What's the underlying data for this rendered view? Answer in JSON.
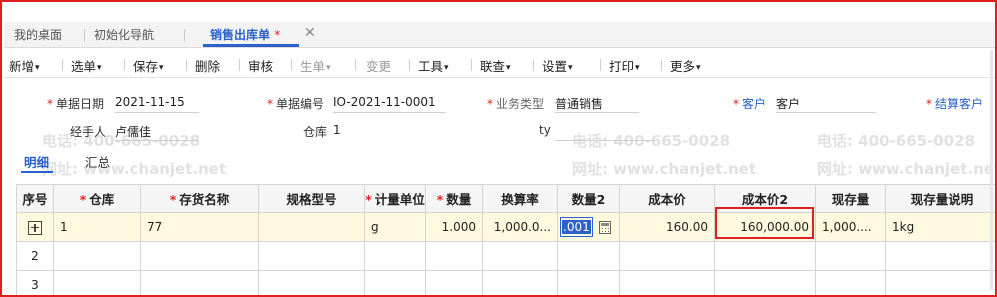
{
  "tabs": {
    "items": [
      {
        "label": "我的桌面"
      },
      {
        "label": "初始化导航"
      },
      {
        "label": "销售出库单",
        "dirty": "*"
      }
    ],
    "close_glyph": "✕"
  },
  "toolbar": {
    "new": "新增",
    "select": "选单",
    "save": "保存",
    "delete": "删除",
    "audit": "审核",
    "generate": "生单",
    "change": "变更",
    "tools": "工具",
    "linked_query": "联查",
    "settings": "设置",
    "print": "打印",
    "more": "更多",
    "caret": "▾"
  },
  "form": {
    "doc_date_label": "单据日期",
    "doc_date": "2021-11-15",
    "doc_no_label": "单据编号",
    "doc_no": "IO-2021-11-0001",
    "biz_type_label": "业务类型",
    "biz_type": "普通销售",
    "customer_label": "客户",
    "customer": "客户",
    "settle_customer_label": "结算客户",
    "handler_label": "经手人",
    "handler": "卢儒佳",
    "warehouse_label": "仓库",
    "warehouse": "1",
    "ty_label": "ty",
    "ty": "",
    "required_mark": "*"
  },
  "detail_tabs": {
    "detail": "明细",
    "summary": "汇总"
  },
  "grid": {
    "columns": [
      {
        "label": "序号",
        "required": false
      },
      {
        "label": "仓库",
        "required": true
      },
      {
        "label": "存货名称",
        "required": true
      },
      {
        "label": "规格型号",
        "required": false
      },
      {
        "label": "计量单位",
        "required": true
      },
      {
        "label": "数量",
        "required": true
      },
      {
        "label": "换算率",
        "required": false
      },
      {
        "label": "数量2",
        "required": false
      },
      {
        "label": "成本价",
        "required": false
      },
      {
        "label": "成本价2",
        "required": false
      },
      {
        "label": "现存量",
        "required": false
      },
      {
        "label": "现存量说明",
        "required": false
      }
    ],
    "rows": [
      {
        "warehouse": "1",
        "item": "77",
        "spec": "",
        "unit": "g",
        "qty": "1.000",
        "rate": "1,000.0...",
        "qty2": ".001",
        "cost": "160.00",
        "cost2": "160,000.00",
        "stock": "1,000....",
        "stock_note": "1kg"
      },
      {
        "index": "2"
      },
      {
        "index": "3"
      }
    ]
  },
  "watermark": {
    "phone": "电话: 400-665-0028",
    "site": "网址: www.chanjet.net"
  }
}
